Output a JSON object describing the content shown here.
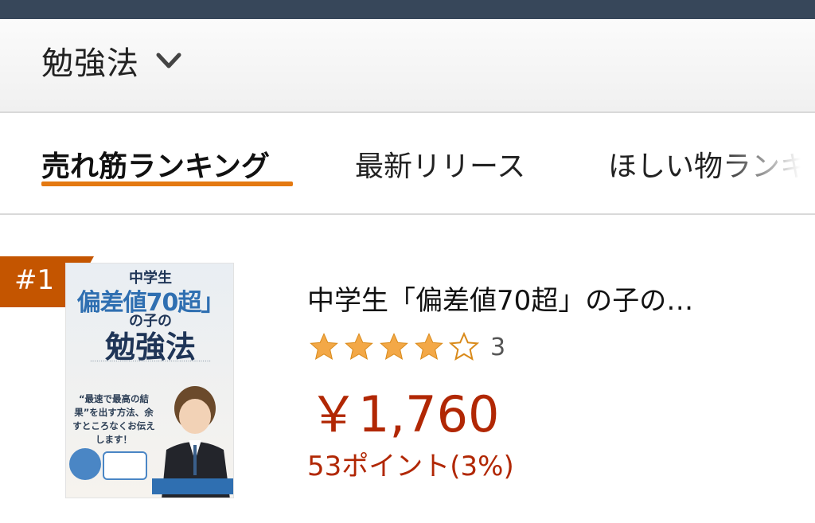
{
  "category": {
    "title": "勉強法"
  },
  "tabs": [
    {
      "label": "売れ筋ランキング",
      "active": true
    },
    {
      "label": "最新リリース"
    },
    {
      "label": "ほしい物ランキング"
    }
  ],
  "colors": {
    "topbar": "#37475a",
    "accent": "#e47911",
    "rank_badge": "#c45500",
    "price": "#b12704",
    "star": "#f3a847"
  },
  "product": {
    "rank": "#1",
    "title": "中学生「偏差値70超」の子の…",
    "rating": {
      "stars": 4,
      "max": 5,
      "count": "3"
    },
    "price": "￥1,760",
    "points": "53ポイント(3%)",
    "cover": {
      "line1": "中学生",
      "line2": "偏差値70超」",
      "line3": "の子の",
      "line4": "勉強法",
      "body": "“最速で最高の結果”を出す方法、余すところなくお伝えします！"
    }
  }
}
